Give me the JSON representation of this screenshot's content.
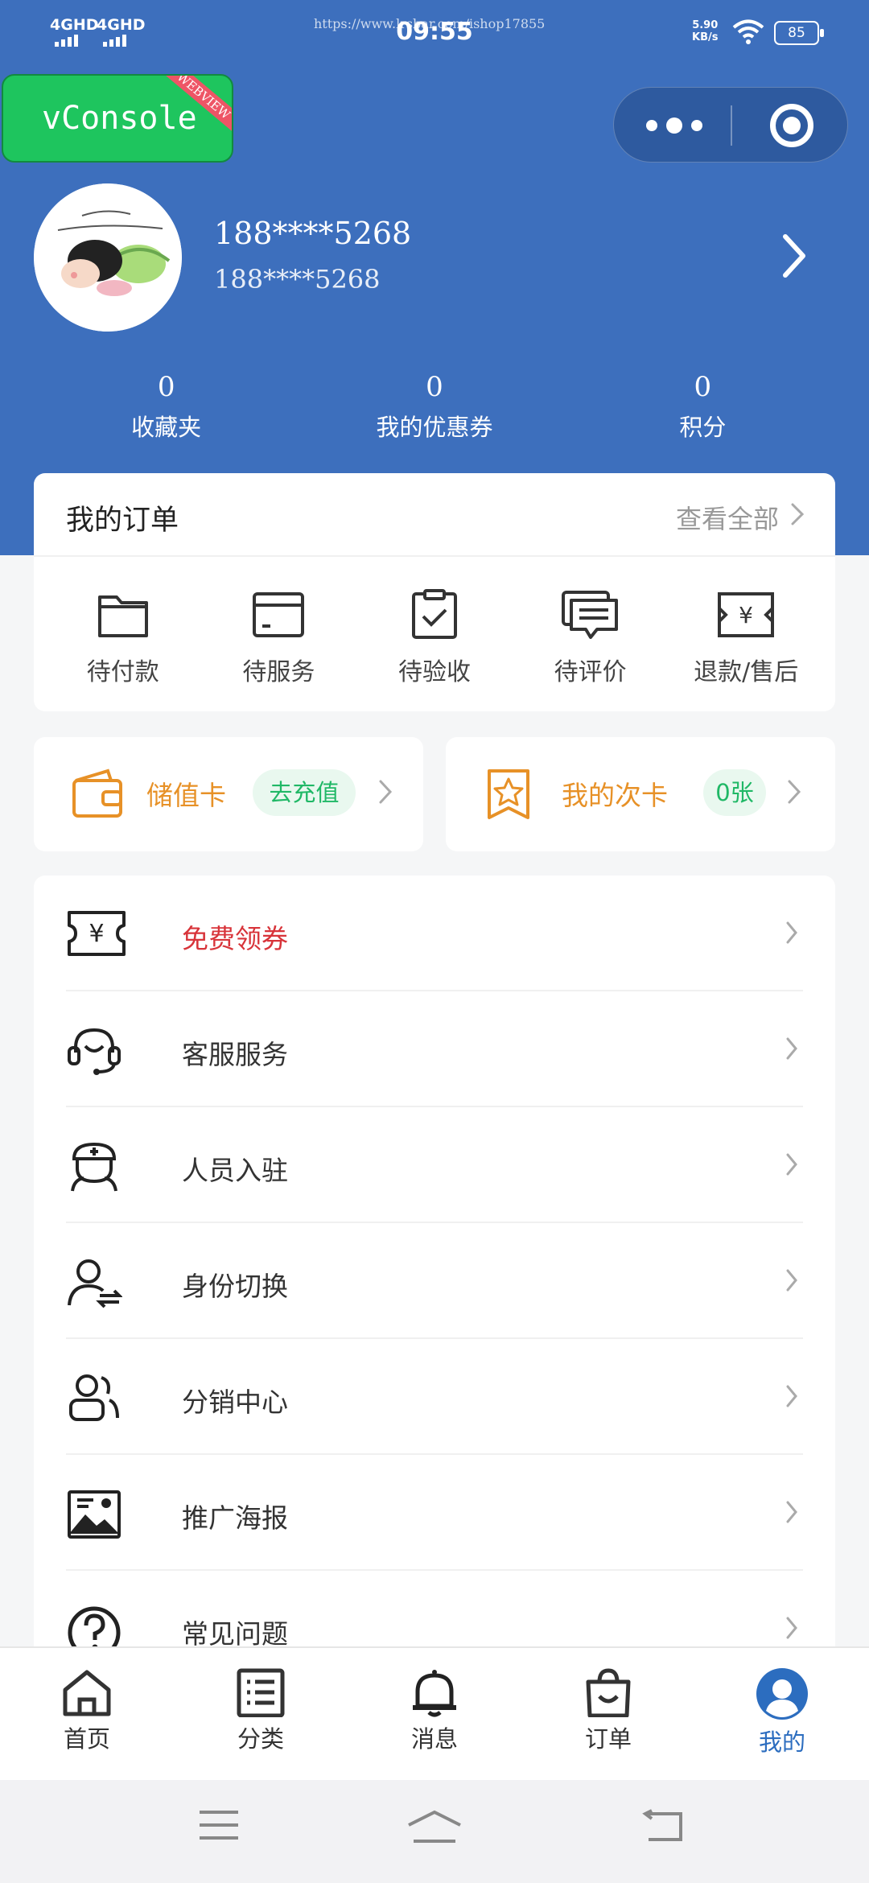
{
  "status_bar": {
    "signal_1": "4GHD",
    "signal_2": "4GHD",
    "time": "09:55",
    "url": "https://www.lrsbar.com/ishop17855",
    "speed_value": "5.90",
    "speed_unit": "KB/s",
    "battery": "85"
  },
  "vconsole": {
    "label": "vConsole",
    "ribbon": "WEBVIEW"
  },
  "capsule": {
    "more_icon": "more-dots-icon",
    "close_icon": "target-icon"
  },
  "profile": {
    "name": "188****5268",
    "phone": "188****5268",
    "avatar_icon": "cartoon-avatar"
  },
  "stats": [
    {
      "value": "0",
      "label": "收藏夹"
    },
    {
      "value": "0",
      "label": "我的优惠券"
    },
    {
      "value": "0",
      "label": "积分"
    }
  ],
  "orders": {
    "title": "我的订单",
    "view_all": "查看全部",
    "items": [
      {
        "label": "待付款",
        "icon": "folder-icon"
      },
      {
        "label": "待服务",
        "icon": "card-icon"
      },
      {
        "label": "待验收",
        "icon": "clipboard-check-icon"
      },
      {
        "label": "待评价",
        "icon": "comment-icon"
      },
      {
        "label": "退款/售后",
        "icon": "refund-ticket-icon"
      }
    ]
  },
  "value_cards": {
    "stored": {
      "title": "储值卡",
      "action": "去充值",
      "icon": "wallet-icon"
    },
    "times": {
      "title": "我的次卡",
      "action": "0张",
      "icon": "star-badge-icon"
    }
  },
  "menu": [
    {
      "label": "免费领券",
      "icon": "coupon-icon",
      "highlight": true
    },
    {
      "label": "客服服务",
      "icon": "headset-icon"
    },
    {
      "label": "人员入驻",
      "icon": "nurse-icon"
    },
    {
      "label": "身份切换",
      "icon": "user-switch-icon"
    },
    {
      "label": "分销中心",
      "icon": "users-icon"
    },
    {
      "label": "推广海报",
      "icon": "poster-icon"
    },
    {
      "label": "常见问题",
      "icon": "question-icon"
    }
  ],
  "tabbar": [
    {
      "label": "首页",
      "icon": "home-icon"
    },
    {
      "label": "分类",
      "icon": "list-icon"
    },
    {
      "label": "消息",
      "icon": "bell-icon"
    },
    {
      "label": "订单",
      "icon": "bag-icon"
    },
    {
      "label": "我的",
      "icon": "profile-icon",
      "active": true
    }
  ],
  "colors": {
    "header_blue": "#3d6fbd",
    "accent_orange": "#e79127",
    "accent_green": "#20b866",
    "highlight_red": "#d8343a",
    "tab_active": "#2c6dbf"
  }
}
